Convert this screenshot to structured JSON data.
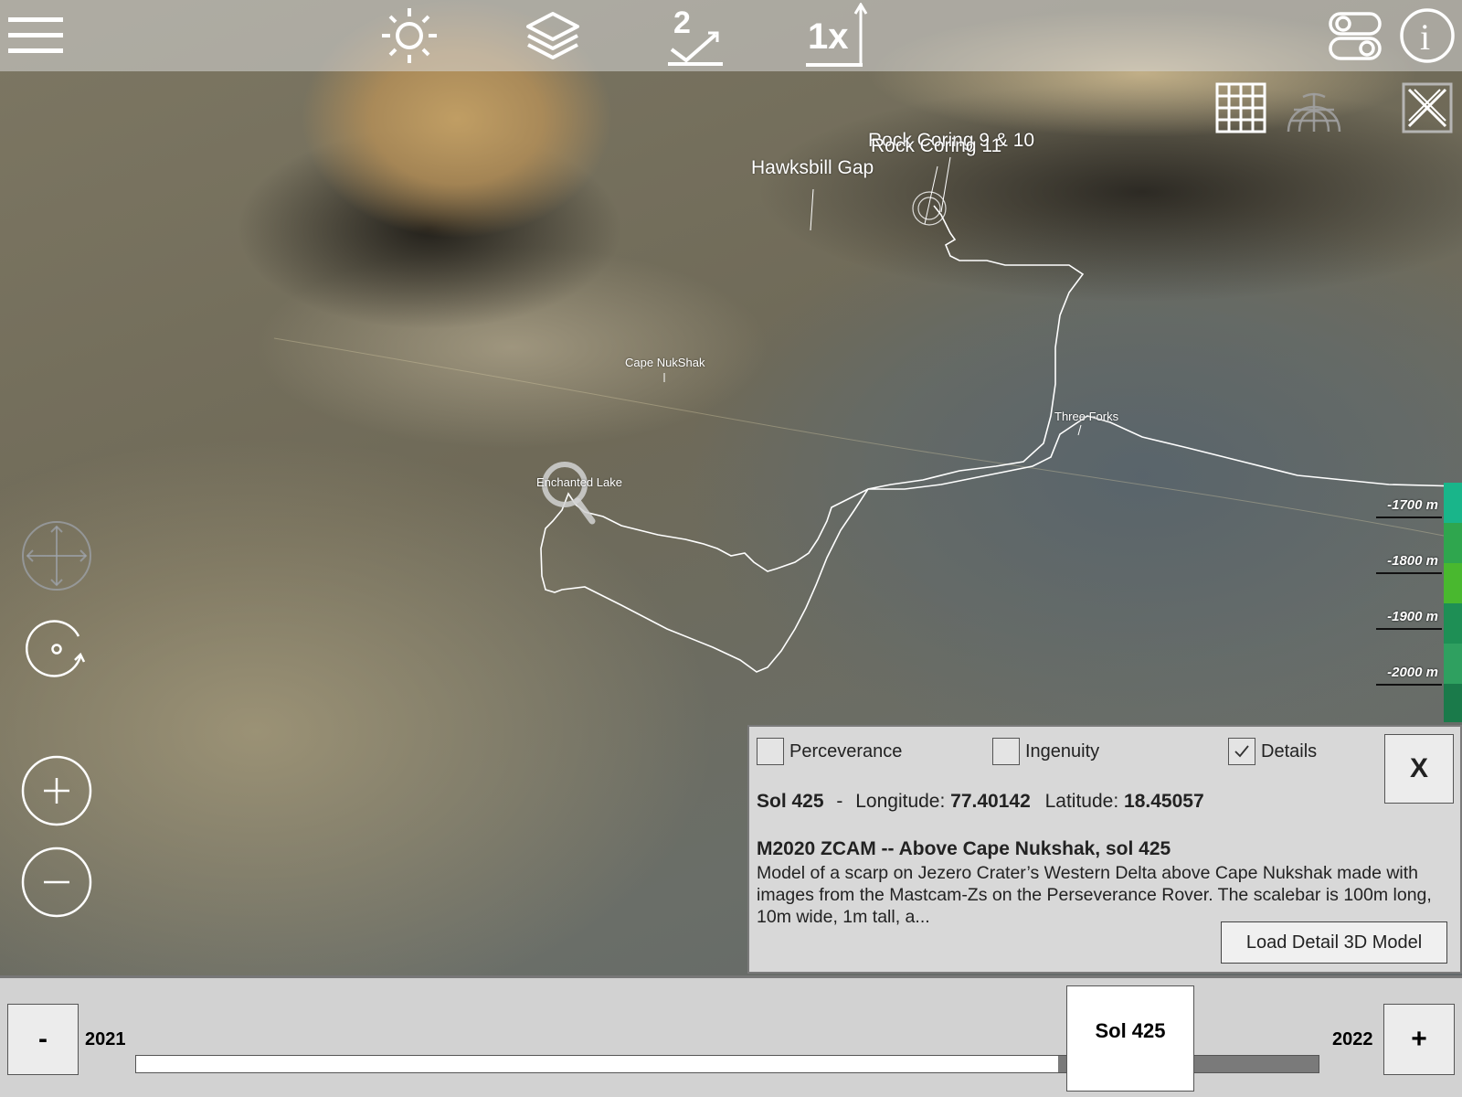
{
  "toolbar": {
    "icons": [
      "menu-icon",
      "brightness-icon",
      "layers-icon",
      "measure-icon",
      "vertical-exaggeration-icon",
      "toggle-settings-icon",
      "info-icon"
    ],
    "measure_label": "2",
    "exaggeration_label": "1x"
  },
  "view_controls": {
    "icons": [
      "grid-icon",
      "globe-wireframe-icon",
      "reset-view-icon"
    ]
  },
  "map_labels": [
    {
      "text": "Rock Coring 9 & 10"
    },
    {
      "text": "Rock Coring 11"
    },
    {
      "text": "Hawksbill Gap"
    },
    {
      "text": "Cape NukShak"
    },
    {
      "text": "Three Forks"
    },
    {
      "text": "Enchanted Lake"
    }
  ],
  "depth_scale": {
    "labels": [
      "-1700 m",
      "-1800 m",
      "-1900 m",
      "-2000 m"
    ],
    "colors": [
      "#19b58a",
      "#2fa64e",
      "#49b82f",
      "#1e8f55",
      "#2fa060",
      "#1a7a4a"
    ]
  },
  "nav_controls": {
    "icons": [
      "pan-icon",
      "rotate-icon",
      "zoom-in-icon",
      "zoom-out-icon"
    ]
  },
  "panel": {
    "checkboxes": [
      {
        "label": "Perceverance",
        "checked": false
      },
      {
        "label": "Ingenuity",
        "checked": false
      },
      {
        "label": "Details",
        "checked": true
      }
    ],
    "close_label": "X",
    "sol_label": "Sol 425",
    "separator": "-",
    "longitude_label": "Longitude:",
    "longitude_value": "77.40142",
    "latitude_label": "Latitude:",
    "latitude_value": "18.45057",
    "title": "M2020 ZCAM -- Above Cape Nukshak, sol 425",
    "description": "Model of a scarp on Jezero Crater’s Western Delta above Cape Nukshak made with images from the Mastcam-Zs on the Perseverance Rover. The scalebar is 100m long, 10m wide, 1m tall, a...",
    "load_button": "Load Detail 3D Model"
  },
  "timeline": {
    "minus_label": "-",
    "plus_label": "+",
    "start_year": "2021",
    "end_year": "2022",
    "current_label": "Sol 425",
    "progress": 0.78
  }
}
